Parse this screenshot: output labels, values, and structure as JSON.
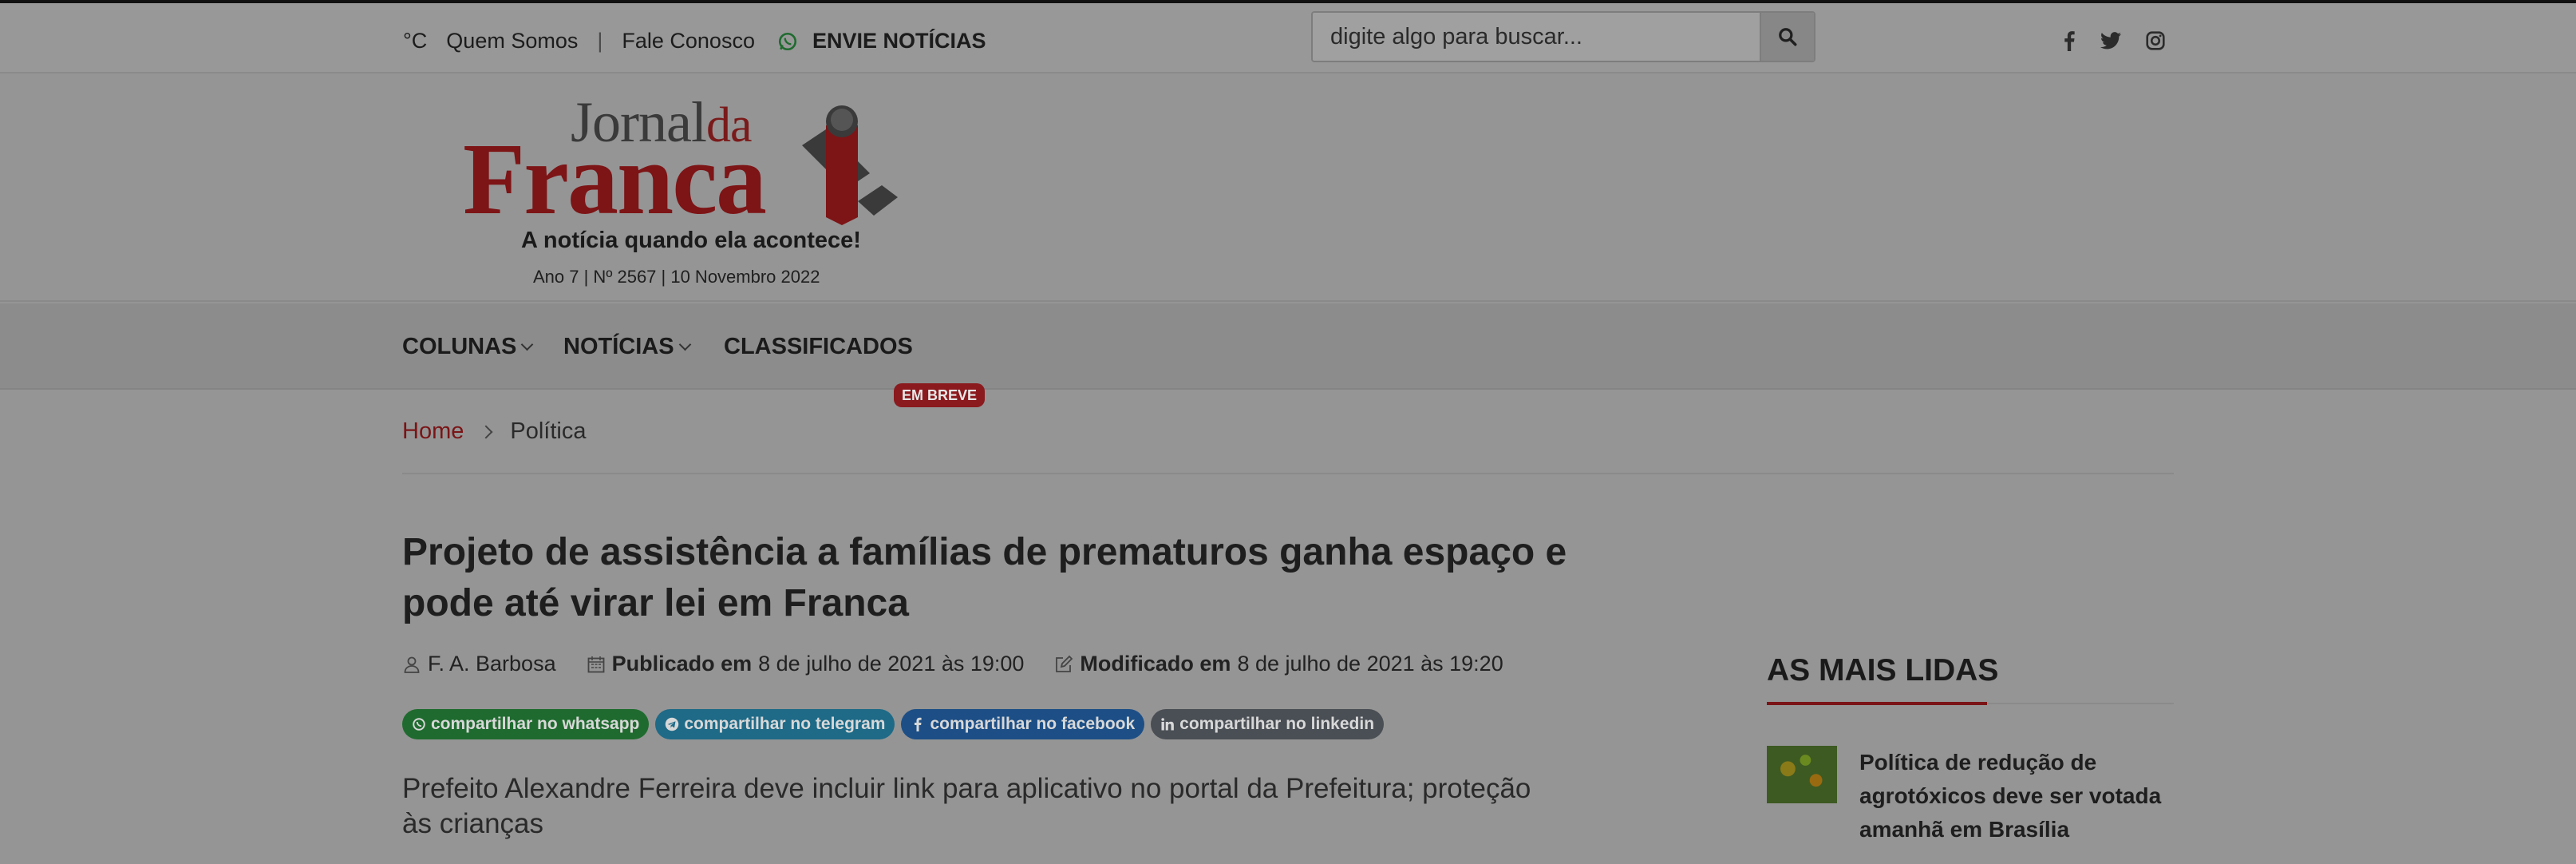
{
  "topbar": {
    "temp": "°C",
    "quem_somos": "Quem Somos",
    "separator": "|",
    "fale_conosco": "Fale Conosco",
    "envie_noticias": "ENVIE NOTÍCIAS",
    "search_placeholder": "digite algo para buscar..."
  },
  "logo": {
    "jornal": "Jornal",
    "da": "da",
    "franca": "Franca",
    "tagline": "A notícia quando ela acontece!",
    "edition": "Ano 7 | Nº 2567 | 10 Novembro 2022"
  },
  "nav": {
    "colunas": "COLUNAS",
    "noticias": "NOTÍCIAS",
    "classificados": "CLASSIFICADOS",
    "badge": "EM BREVE"
  },
  "breadcrumb": {
    "home": "Home",
    "current": "Política"
  },
  "article": {
    "title": "Projeto de assistência a famílias de prematuros ganha espaço e pode até virar lei em Franca",
    "author": "F. A. Barbosa",
    "published_label": "Publicado em",
    "published": "8 de julho de 2021 às 19:00",
    "modified_label": "Modificado em",
    "modified": "8 de julho de 2021 às 19:20",
    "lead": "Prefeito Alexandre Ferreira deve incluir link para aplicativo no portal da Prefeitura; proteção às crianças"
  },
  "share": {
    "whatsapp": "compartilhar no whatsapp",
    "telegram": "compartilhar no telegram",
    "facebook": "compartilhar no facebook",
    "linkedin": "compartilhar no linkedin"
  },
  "sidebar": {
    "title": "AS MAIS LIDAS",
    "items": [
      {
        "text": "Política de redução de agrotóxicos deve ser votada amanhã em Brasília"
      }
    ]
  },
  "colors": {
    "brand_red": "#7d1416",
    "whatsapp": "#1f6b2f",
    "telegram": "#1e6a87",
    "facebook": "#1d4f86",
    "linkedin": "#4a4f55"
  }
}
